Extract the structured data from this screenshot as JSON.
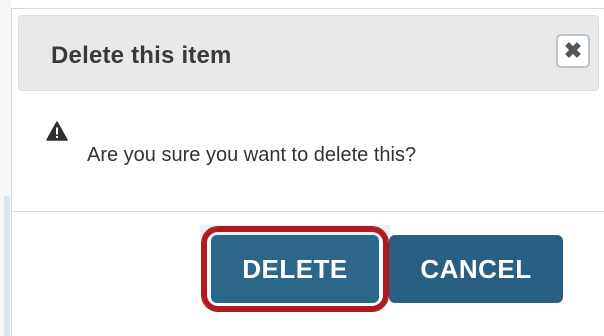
{
  "dialog": {
    "title": "Delete this item",
    "close_symbol": "✖",
    "message": "Are you sure you want to delete this?",
    "warning_icon": "warning-triangle-icon",
    "close_icon": "close-x-icon"
  },
  "actions": {
    "delete_label": "DELETE",
    "cancel_label": "CANCEL",
    "highlighted_button": "delete"
  },
  "colors": {
    "header_bg": "#e9e9e9",
    "button_primary": "#2c6689",
    "highlight_outline": "#b21a21",
    "text_dark": "#333333"
  }
}
